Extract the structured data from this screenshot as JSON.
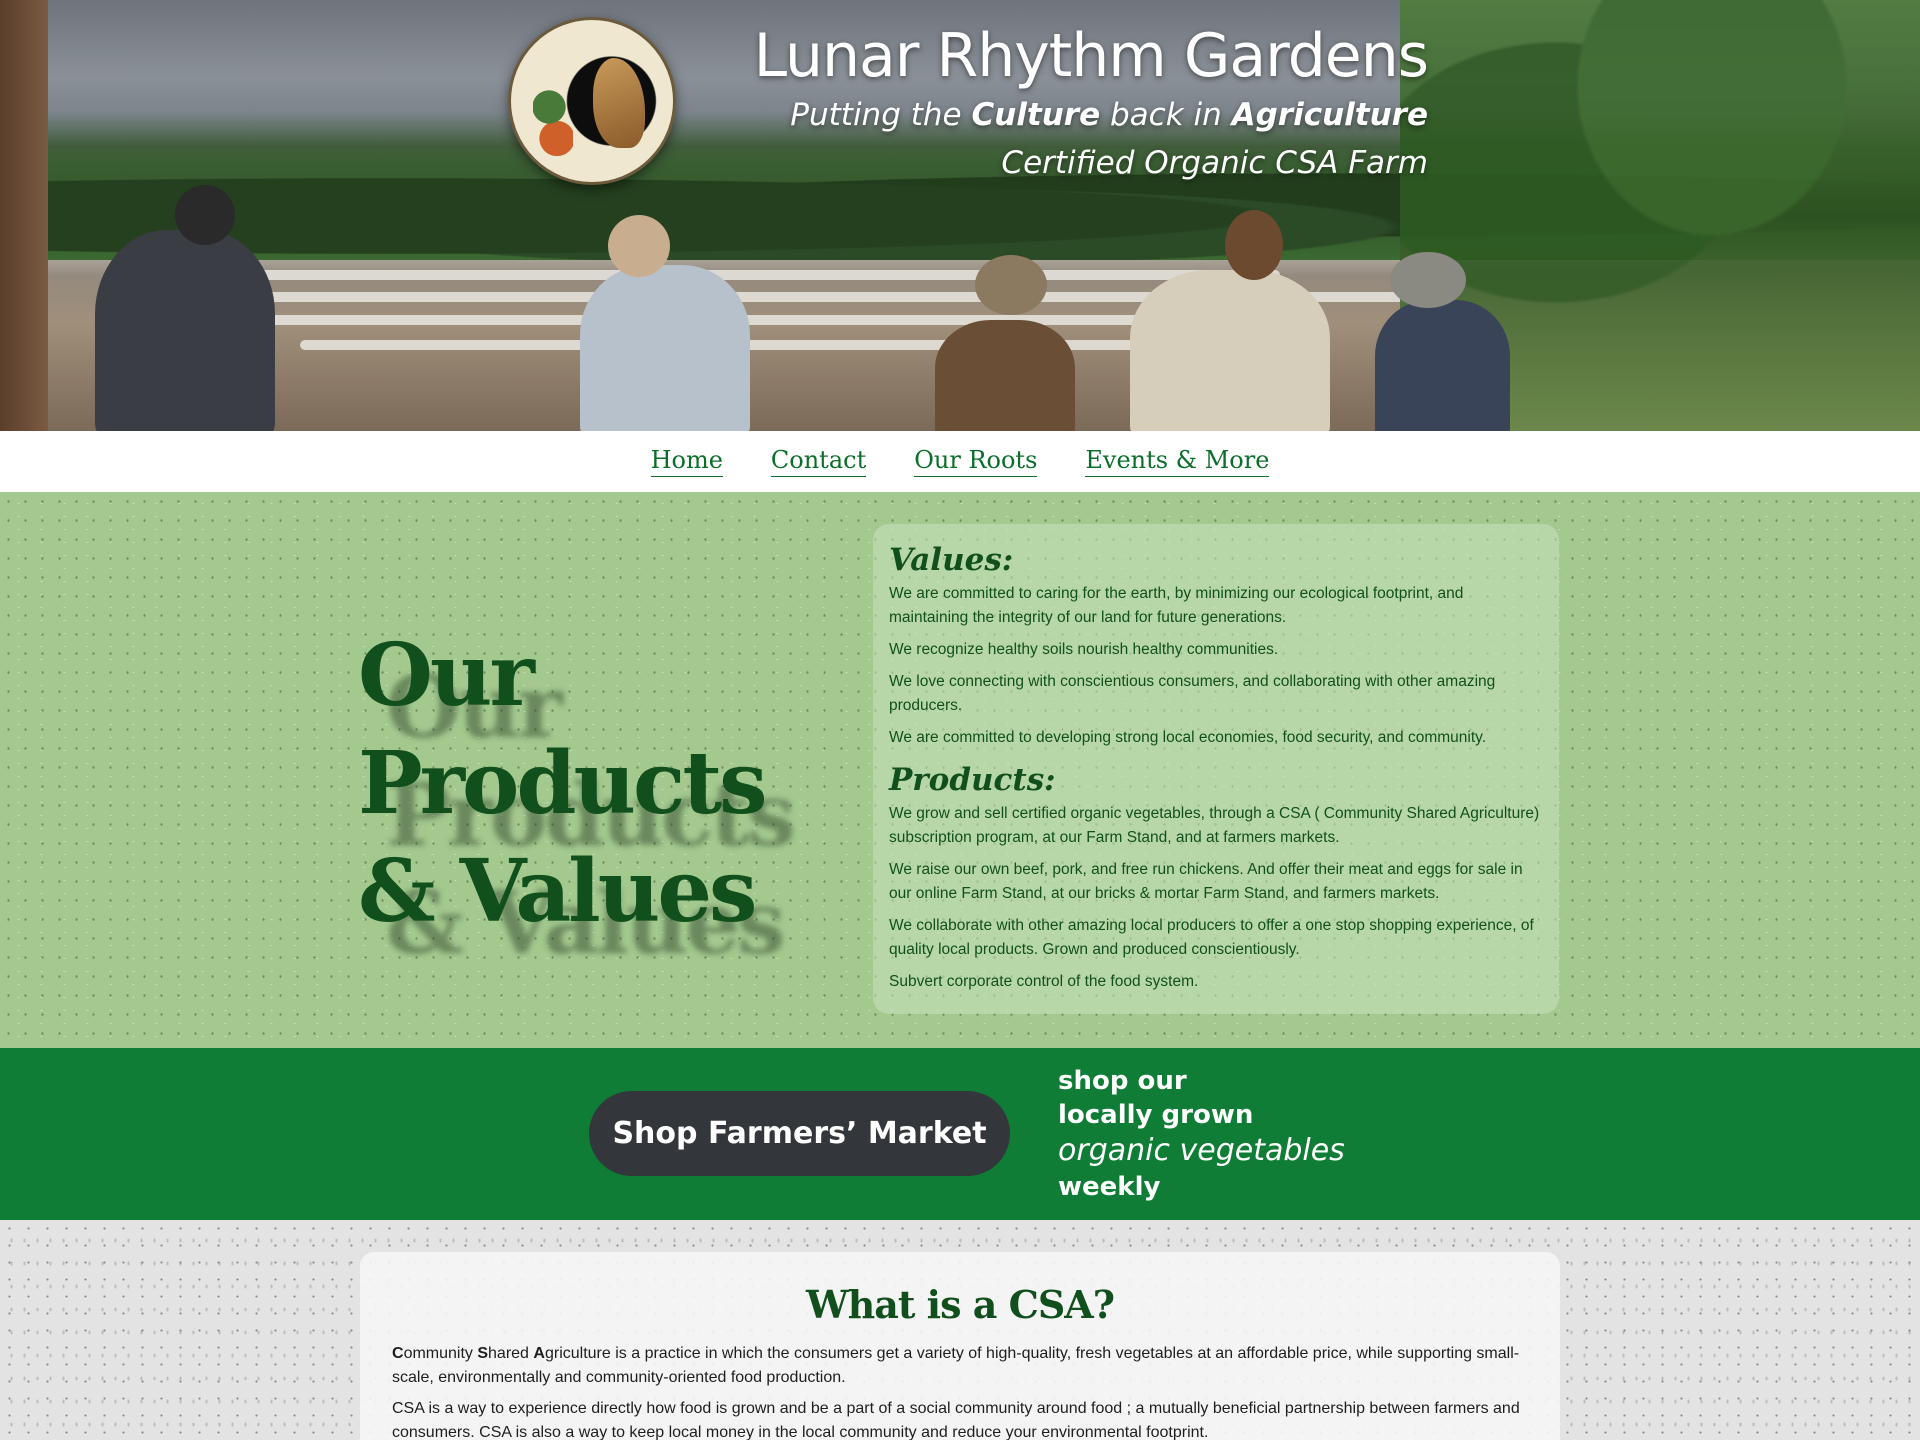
{
  "header": {
    "site_title": "Lunar Rhythm Gardens",
    "tagline_pre": "Putting the ",
    "tagline_bold1": "Culture",
    "tagline_mid": " back in ",
    "tagline_bold2": "Agriculture",
    "subtagline": "Certified Organic CSA Farm"
  },
  "nav": {
    "items": [
      {
        "label": "Home"
      },
      {
        "label": "Contact"
      },
      {
        "label": "Our Roots"
      },
      {
        "label": "Events & More"
      }
    ]
  },
  "values_section": {
    "heading_line1": "Our",
    "heading_line2": "Products",
    "heading_line3": "& Values",
    "values_title": "Values:",
    "values": [
      "We are committed to caring for the earth, by minimizing our ecological footprint, and maintaining the integrity of our land for future generations.",
      "We recognize healthy soils nourish healthy communities.",
      "We love connecting with conscientious consumers, and collaborating with other amazing producers.",
      "We are committed to developing strong local economies, food security, and community."
    ],
    "products_title": "Products:",
    "products": [
      "We grow and sell certified organic vegetables, through a CSA ( Community Shared Agriculture) subscription program, at our Farm Stand, and at farmers markets.",
      "We raise our own beef, pork, and free run chickens. And offer their meat and eggs for sale in our online  Farm Stand, at our bricks & mortar Farm Stand, and farmers markets.",
      "We collaborate with other amazing local producers to offer a one stop shopping experience, of quality local products. Grown and produced conscientiously.",
      "Subvert corporate control of the food system."
    ]
  },
  "shop_bar": {
    "button_label": "Shop Farmers’ Market",
    "line1": "shop our",
    "line2": "locally grown",
    "line3": "organic vegetables",
    "line4": "weekly"
  },
  "csa_section": {
    "title": "What is a CSA?",
    "p1_c": "C",
    "p1_ommunity": "ommunity ",
    "p1_s": "S",
    "p1_hared": "hared ",
    "p1_a": "A",
    "p1_rest": "griculture is a practice in which the consumers get a variety of high-quality, fresh vegetables at an affordable price, while supporting small-scale, environmentally and community-oriented food production.",
    "p2": "CSA is a way to experience directly how food is grown and be a part of a social community around food ; a mutually beneficial partnership between farmers and consumers.  CSA is also a way to keep local money in the local community and reduce your environmental footprint."
  },
  "colors": {
    "brand_green": "#0f7d36",
    "dark_green_text": "#11501c",
    "nav_link": "#0b6e2a",
    "values_bg": "#a3c98f",
    "button_dark": "#33363a"
  }
}
